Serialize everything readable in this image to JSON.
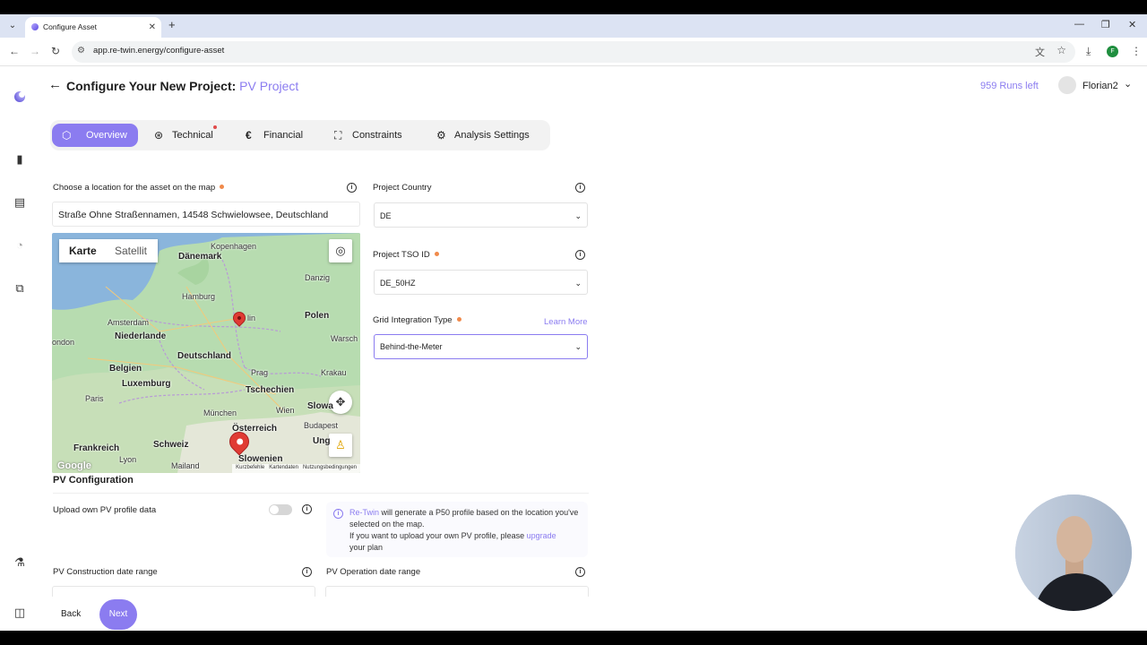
{
  "browser": {
    "tab_title": "Configure Asset",
    "url": "app.re-twin.energy/configure-asset",
    "profile_initial": "F"
  },
  "header": {
    "title_prefix": "Configure Your New Project:",
    "title_project": "PV Project",
    "runs_left": "959 Runs left",
    "user_name": "Florian2"
  },
  "tabs": [
    {
      "label": "Overview",
      "icon": "cube-icon",
      "active": true
    },
    {
      "label": "Technical",
      "icon": "technical-icon",
      "has_dot": true
    },
    {
      "label": "Financial",
      "icon": "euro-icon"
    },
    {
      "label": "Constraints",
      "icon": "constraints-icon"
    },
    {
      "label": "Analysis Settings",
      "icon": "gear-icon"
    }
  ],
  "location": {
    "label": "Choose a location for the asset on the map",
    "value": "Straße Ohne Straßennamen, 14548 Schwielowsee, Deutschland"
  },
  "map": {
    "type_options": [
      "Karte",
      "Satellit"
    ],
    "labels": {
      "danemark": "Dänemark",
      "kopenhagen": "Kopenhagen",
      "danzig": "Danzig",
      "hamburg": "Hamburg",
      "lin": "lin",
      "polen": "Polen",
      "amsterdam": "Amsterdam",
      "warsch": "Warsch",
      "ondon": "ondon",
      "niederlande": "Niederlande",
      "deutschland": "Deutschland",
      "belgien": "Belgien",
      "krakau": "Krakau",
      "prag": "Prag",
      "luxemburg": "Luxemburg",
      "tschechien": "Tschechien",
      "paris": "Paris",
      "wien": "Wien",
      "slowa": "Slowa",
      "munchen": "München",
      "budapest": "Budapest",
      "osterreich": "Österreich",
      "frankreich": "Frankreich",
      "schweiz": "Schweiz",
      "ung": "Ung",
      "lyon": "Lyon",
      "slowenien": "Slowenien",
      "mailand": "Mailand"
    },
    "footer": {
      "shortcuts": "Kurzbefehle",
      "data": "Kartendaten",
      "terms": "Nutzungsbedingungen"
    },
    "google": "Google"
  },
  "country": {
    "label": "Project Country",
    "value": "DE"
  },
  "tso": {
    "label": "Project TSO ID",
    "value": "DE_50HZ"
  },
  "grid": {
    "label": "Grid Integration Type",
    "learn_more": "Learn More",
    "value": "Behind-the-Meter"
  },
  "pv": {
    "section_title": "PV Configuration",
    "upload_label": "Upload own PV profile data",
    "info_brand": "Re-Twin",
    "info_text1": " will generate a P50 profile based on the location you've selected on the map.",
    "info_text2": "If you want to upload your own PV profile, please ",
    "info_link": "upgrade",
    "info_text3": " your plan",
    "construction_label": "PV Construction date range",
    "operation_label": "PV Operation date range"
  },
  "footer_buttons": {
    "back": "Back",
    "next": "Next"
  },
  "colors": {
    "accent": "#8b7cf0",
    "required_dot": "#f08a4b"
  }
}
